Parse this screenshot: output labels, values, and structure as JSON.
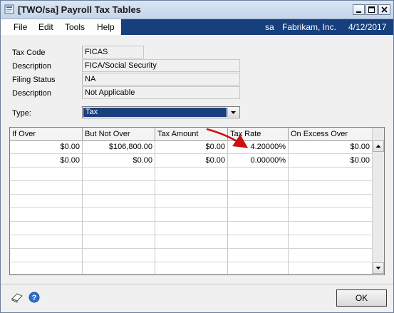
{
  "window": {
    "title": "[TWO/sa] Payroll Tax Tables"
  },
  "icons": {
    "app": "app-icon",
    "minimize": "minimize-icon",
    "maximize": "maximize-icon",
    "close": "close-icon",
    "note": "note-icon",
    "help": "help-icon",
    "dropdown": "chevron-down-icon",
    "scroll_up": "scroll-up-icon",
    "scroll_down": "scroll-down-icon",
    "annotation": "red-arrow-annotation"
  },
  "menu": {
    "file": "File",
    "edit": "Edit",
    "tools": "Tools",
    "help": "Help"
  },
  "session": {
    "user": "sa",
    "company": "Fabrikam, Inc.",
    "date": "4/12/2017"
  },
  "header": {
    "tax_code_label": "Tax Code",
    "tax_code": "FICAS",
    "description_label": "Description",
    "description": "FICA/Social Security",
    "filing_status_label": "Filing Status",
    "filing_status": "NA",
    "description2_label": "Description",
    "description2": "Not Applicable"
  },
  "type": {
    "label": "Type:",
    "value": "Tax"
  },
  "table": {
    "columns": [
      "If Over",
      "But Not Over",
      "Tax Amount",
      "Tax Rate",
      "On Excess Over"
    ],
    "rows": [
      [
        "$0.00",
        "$106,800.00",
        "$0.00",
        "4.20000%",
        "$0.00"
      ],
      [
        "$0.00",
        "$0.00",
        "$0.00",
        "0.00000%",
        "$0.00"
      ]
    ]
  },
  "buttons": {
    "ok": "OK"
  },
  "colors": {
    "selection": "#1b3f7e",
    "menu_band": "#173f7e",
    "arrow": "#cc1111"
  }
}
